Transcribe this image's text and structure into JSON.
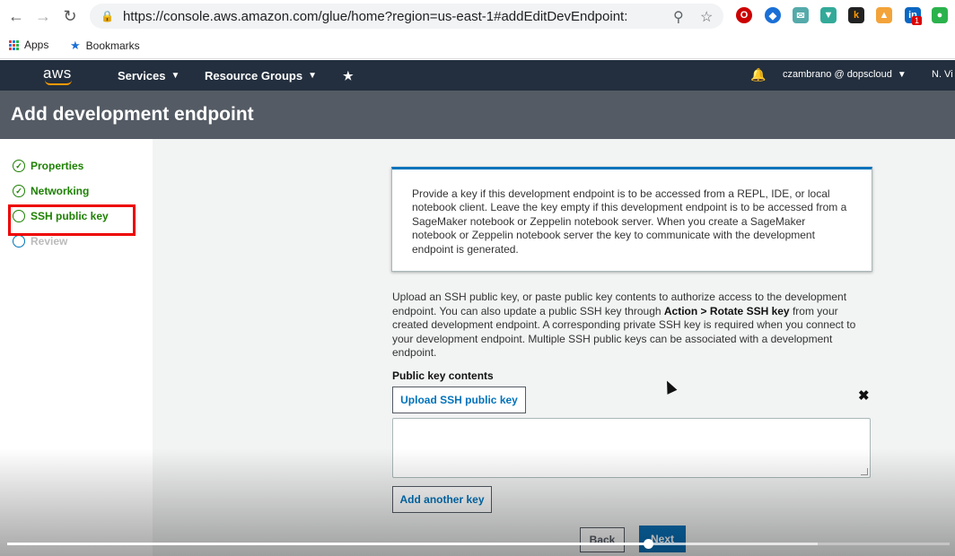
{
  "browser": {
    "url": "https://console.aws.amazon.com/glue/home?region=us-east-1#addEditDevEndpoint:",
    "bookmarks": [
      "Apps",
      "Bookmarks"
    ],
    "extension_badge": "1",
    "ext_k_label": "k"
  },
  "aws_header": {
    "logo": "aws",
    "services": "Services",
    "resource_groups": "Resource Groups",
    "user": "czambrano @ dopscloud",
    "region": "N. Vi"
  },
  "page_title": "Add development endpoint",
  "steps": [
    {
      "label": "Properties",
      "state": "done"
    },
    {
      "label": "Networking",
      "state": "done"
    },
    {
      "label": "SSH public key",
      "state": "current"
    },
    {
      "label": "Review",
      "state": "pending"
    }
  ],
  "info_text": "Provide a key if this development endpoint is to be accessed from a REPL, IDE, or local notebook client. Leave the key empty if this development endpoint is to be accessed from a SageMaker notebook or Zeppelin notebook server. When you create a SageMaker notebook or Zeppelin notebook server the key to communicate with the development endpoint is generated.",
  "description": {
    "part1": "Upload an SSH public key, or paste public key contents to authorize access to the development endpoint. You can also update a public SSH key through ",
    "bold": "Action > Rotate SSH key",
    "part2": " from your created development endpoint. A corresponding private SSH key is required when you connect to your development endpoint. Multiple SSH public keys can be associated with a development endpoint."
  },
  "public_key_label": "Public key contents",
  "upload_button": "Upload SSH public key",
  "remove_icon": "✖",
  "textarea_value": "",
  "add_another_key": "Add another key",
  "back_button": "Back",
  "next_button": "Next",
  "video_progress": 0.68,
  "colors": {
    "aws_nav": "#232f3e",
    "title_bar": "#545b64",
    "step_green": "#1d8102",
    "link_blue": "#0073bb",
    "highlight_red": "#e00000"
  }
}
